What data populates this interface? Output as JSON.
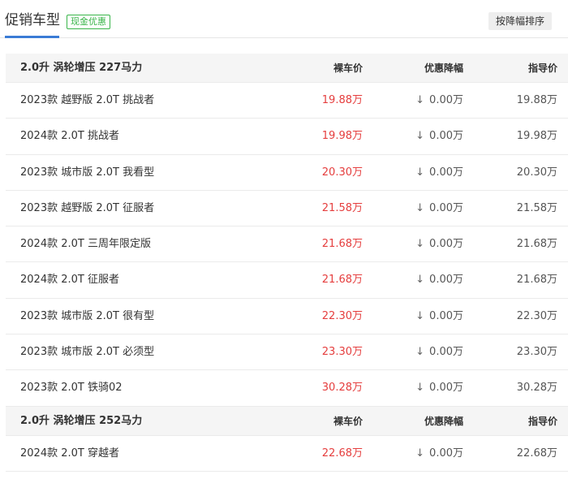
{
  "header": {
    "tab_label": "促销车型",
    "badge": "现金优惠",
    "sort_button": "按降幅排序"
  },
  "columns": {
    "bare_price": "裸车价",
    "discount": "优惠降幅",
    "guide_price": "指导价"
  },
  "groups": [
    {
      "title": "2.0升 涡轮增压 227马力",
      "rows": [
        {
          "name": "2023款 越野版 2.0T 挑战者",
          "bare_price": "19.88万",
          "discount": "0.00万",
          "guide_price": "19.88万"
        },
        {
          "name": "2024款 2.0T 挑战者",
          "bare_price": "19.98万",
          "discount": "0.00万",
          "guide_price": "19.98万"
        },
        {
          "name": "2023款 城市版 2.0T 我看型",
          "bare_price": "20.30万",
          "discount": "0.00万",
          "guide_price": "20.30万"
        },
        {
          "name": "2023款 越野版 2.0T 征服者",
          "bare_price": "21.58万",
          "discount": "0.00万",
          "guide_price": "21.58万"
        },
        {
          "name": "2024款 2.0T 三周年限定版",
          "bare_price": "21.68万",
          "discount": "0.00万",
          "guide_price": "21.68万"
        },
        {
          "name": "2024款 2.0T 征服者",
          "bare_price": "21.68万",
          "discount": "0.00万",
          "guide_price": "21.68万"
        },
        {
          "name": "2023款 城市版 2.0T 很有型",
          "bare_price": "22.30万",
          "discount": "0.00万",
          "guide_price": "22.30万"
        },
        {
          "name": "2023款 城市版 2.0T 必须型",
          "bare_price": "23.30万",
          "discount": "0.00万",
          "guide_price": "23.30万"
        },
        {
          "name": "2023款 2.0T 铁骑02",
          "bare_price": "30.28万",
          "discount": "0.00万",
          "guide_price": "30.28万"
        }
      ]
    },
    {
      "title": "2.0升 涡轮增压 252马力",
      "rows": [
        {
          "name": "2024款 2.0T 穿越者",
          "bare_price": "22.68万",
          "discount": "0.00万",
          "guide_price": "22.68万"
        }
      ]
    }
  ],
  "icons": {
    "down_arrow": "↓"
  },
  "colors": {
    "price_red": "#e53e3e",
    "badge_green": "#39b54a",
    "tab_blue": "#3a7bd5"
  }
}
